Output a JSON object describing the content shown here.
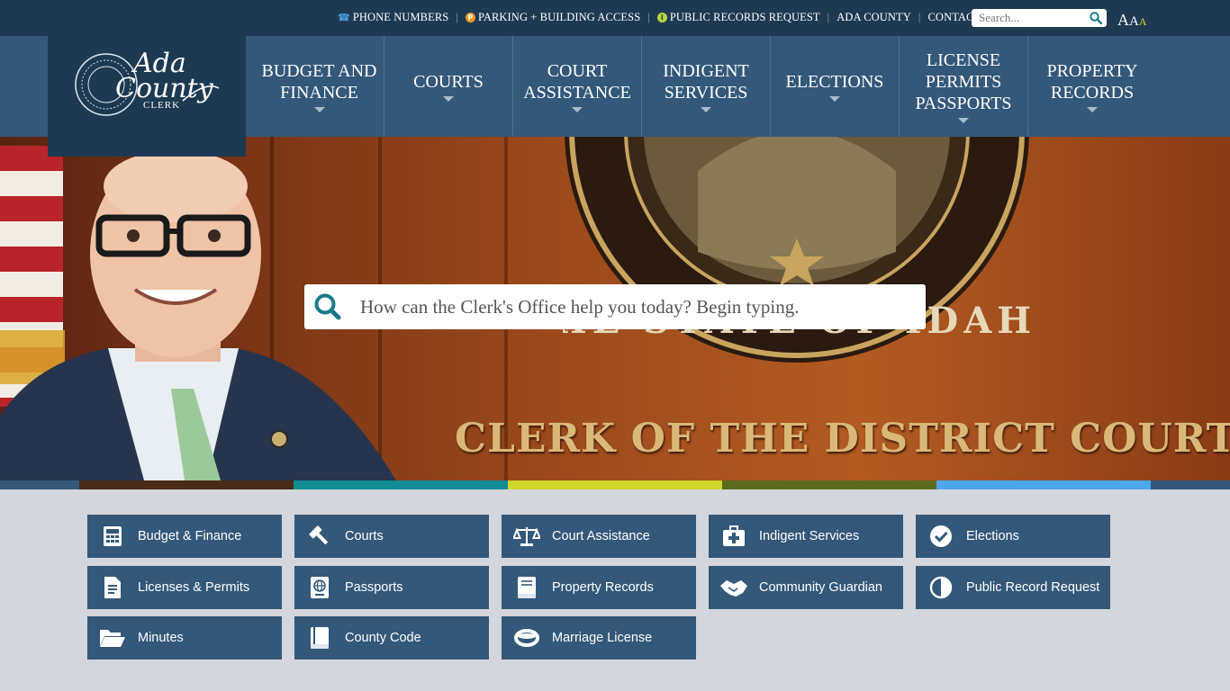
{
  "utility_links": [
    {
      "label": "PHONE NUMBERS",
      "icon": "phone-icon"
    },
    {
      "label": "PARKING + BUILDING ACCESS",
      "icon": "parking-icon"
    },
    {
      "label": "PUBLIC RECORDS REQUEST",
      "icon": "info-icon"
    },
    {
      "label": "ADA COUNTY",
      "icon": ""
    },
    {
      "label": "CONTACT",
      "icon": ""
    }
  ],
  "top_search": {
    "placeholder": "Search..."
  },
  "text_size": {
    "label": "AAA"
  },
  "logo": {
    "line1": "Ada",
    "line2": "County",
    "line3": "CLERK",
    "ring": "DISTRICT COURT 4TH JUDICIAL"
  },
  "nav": [
    {
      "label": "BUDGET AND\nFINANCE"
    },
    {
      "label": "COURTS"
    },
    {
      "label": "COURT\nASSISTANCE"
    },
    {
      "label": "INDIGENT\nSERVICES"
    },
    {
      "label": "ELECTIONS"
    },
    {
      "label": "LICENSE\nPERMITS\nPASSPORTS"
    },
    {
      "label": "PROPERTY\nRECORDS"
    }
  ],
  "hero": {
    "search_placeholder": "How can the Clerk's Office help you today? Begin typing.",
    "wall_text": "CLERK OF THE DISTRICT COURT",
    "seal_text": "THE STATE OF IDAHO"
  },
  "strip_colors": [
    "#33587a",
    "#4a2c1a",
    "#118c94",
    "#d0d62a",
    "#5d6b1e",
    "#4da6e8",
    "#33587a"
  ],
  "colors": {
    "navy": "#1e3a52",
    "nav_blue": "#33587a",
    "tile_blue": "#33587a",
    "background": "#d3d6dc"
  },
  "tiles": [
    {
      "label": "Budget & Finance",
      "icon": "calculator-icon"
    },
    {
      "label": "Courts",
      "icon": "gavel-icon"
    },
    {
      "label": "Court Assistance",
      "icon": "scales-icon"
    },
    {
      "label": "Indigent Services",
      "icon": "first-aid-kit-icon"
    },
    {
      "label": "Elections",
      "icon": "check-circle-icon"
    },
    {
      "label": "Licenses & Permits",
      "icon": "document-icon"
    },
    {
      "label": "Passports",
      "icon": "passport-icon"
    },
    {
      "label": "Property Records",
      "icon": "book-icon"
    },
    {
      "label": "Community Guardian",
      "icon": "handshake-icon"
    },
    {
      "label": "Public Record Request",
      "icon": "half-circle-icon"
    },
    {
      "label": "Minutes",
      "icon": "folder-open-icon"
    },
    {
      "label": "County Code",
      "icon": "code-book-icon"
    },
    {
      "label": "Marriage License",
      "icon": "ring-icon"
    }
  ]
}
